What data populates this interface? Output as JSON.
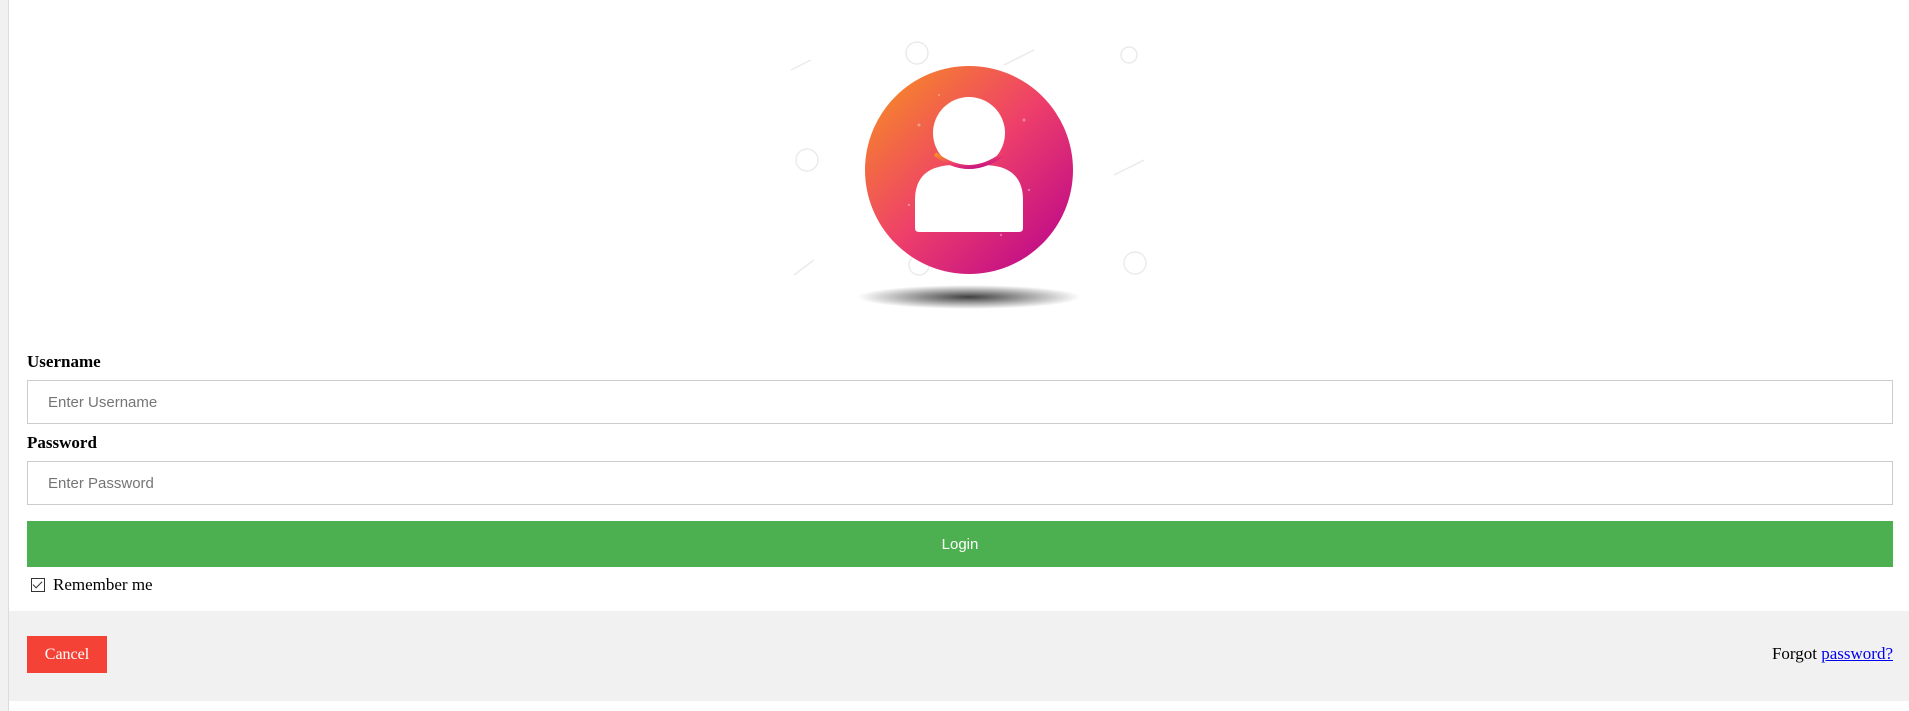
{
  "colors": {
    "login_button": "#4caf50",
    "cancel_button": "#f44336",
    "footer_background": "#f1f1f1",
    "link": "#0000ee",
    "avatar_gradient_start": "#f7941d",
    "avatar_gradient_middle": "#ee3f6a",
    "avatar_gradient_end": "#b5008f"
  },
  "avatar": {
    "icon": "user-avatar-icon"
  },
  "form": {
    "username_label": "Username",
    "username_placeholder": "Enter Username",
    "username_value": "",
    "password_label": "Password",
    "password_placeholder": "Enter Password",
    "password_value": "",
    "login_label": "Login",
    "remember_label": "Remember me",
    "remember_checked": true
  },
  "footer": {
    "cancel_label": "Cancel",
    "forgot_prefix": "Forgot",
    "forgot_link": "password?"
  }
}
